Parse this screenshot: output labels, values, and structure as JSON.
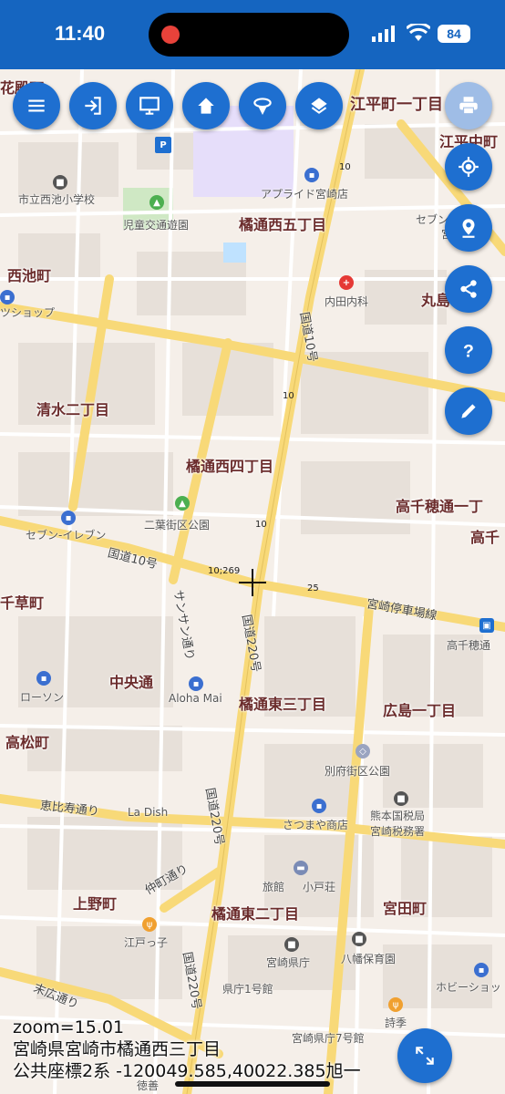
{
  "status_bar": {
    "time": "11:40",
    "battery": "84"
  },
  "toolbar": {
    "menu_icon": "menu-icon",
    "login_icon": "login-icon",
    "display_icon": "monitor-icon",
    "home_icon": "home-icon",
    "gps_icon": "gps-tracking-icon",
    "layers_icon": "layers-icon",
    "print_icon": "print-icon"
  },
  "side_buttons": [
    "my-location-icon",
    "place-pin-icon",
    "share-icon",
    "help-icon",
    "edit-icon"
  ],
  "map": {
    "areas": [
      {
        "id": "hirado",
        "text": "花殿町"
      },
      {
        "id": "ehira1",
        "text": "江平町一丁目"
      },
      {
        "id": "ehirachu",
        "text": "江平中町"
      },
      {
        "id": "tachibana5w",
        "text": "橘通西五丁目"
      },
      {
        "id": "nishiike",
        "text": "西池町"
      },
      {
        "id": "maru",
        "text": "丸島"
      },
      {
        "id": "shimizu2",
        "text": "清水二丁目"
      },
      {
        "id": "tachibana4w",
        "text": "橘通西四丁目"
      },
      {
        "id": "takachiho1",
        "text": "高千穂通一丁"
      },
      {
        "id": "takachiho",
        "text": "高千"
      },
      {
        "id": "chigusa",
        "text": "千草町"
      },
      {
        "id": "chuo",
        "text": "中央通"
      },
      {
        "id": "tachibana3e",
        "text": "橘通東三丁目"
      },
      {
        "id": "hiroshima1",
        "text": "広島一丁目"
      },
      {
        "id": "takamatsu",
        "text": "高松町"
      },
      {
        "id": "ueno",
        "text": "上野町"
      },
      {
        "id": "tachibana2e",
        "text": "橘通東二丁目"
      },
      {
        "id": "miyata",
        "text": "宮田町"
      }
    ],
    "places": [
      {
        "id": "school",
        "text": "市立西池小学校"
      },
      {
        "id": "park1",
        "text": "児童交通遊園"
      },
      {
        "id": "pharm",
        "text": "アプライド宮崎店"
      },
      {
        "id": "clinic",
        "text": "内田内科"
      },
      {
        "id": "shop",
        "text": "ツショップ"
      },
      {
        "id": "seven1",
        "text": "セブン-イレブン"
      },
      {
        "id": "park2",
        "text": "二葉街区公園"
      },
      {
        "id": "lawson",
        "text": "ローソン"
      },
      {
        "id": "aloha",
        "text": "Aloha Mai"
      },
      {
        "id": "takachihost",
        "text": "高千穂通"
      },
      {
        "id": "beppu",
        "text": "別府街区公園"
      },
      {
        "id": "tax",
        "text": "熊本国税局"
      },
      {
        "id": "tax2",
        "text": "宮崎税務署"
      },
      {
        "id": "satsuma",
        "text": "さつまや商店"
      },
      {
        "id": "ladish",
        "text": "La Dish"
      },
      {
        "id": "ryokan",
        "text": "旅館"
      },
      {
        "id": "koyaso",
        "text": "小戸荘"
      },
      {
        "id": "edokko",
        "text": "江戸っ子"
      },
      {
        "id": "pref",
        "text": "宮崎県庁"
      },
      {
        "id": "nursery",
        "text": "八幡保育園"
      },
      {
        "id": "kencho1",
        "text": "県庁1号館"
      },
      {
        "id": "kencho7",
        "text": "宮崎県庁7号館"
      },
      {
        "id": "shiki",
        "text": "詩季"
      },
      {
        "id": "hobby",
        "text": "ホビーショッ"
      },
      {
        "id": "seven2",
        "text": "セブン"
      },
      {
        "id": "miyazaki",
        "text": "宮崎"
      },
      {
        "id": "tokusho",
        "text": "徳善"
      }
    ],
    "roads": [
      {
        "id": "r10a",
        "text": "国道10号"
      },
      {
        "id": "r10b",
        "text": "国道10号"
      },
      {
        "id": "r220a",
        "text": "国道220号"
      },
      {
        "id": "r220b",
        "text": "国道220号"
      },
      {
        "id": "r220c",
        "text": "国道220号"
      },
      {
        "id": "sansan",
        "text": "サンサン通り"
      },
      {
        "id": "teisha",
        "text": "宮崎停車場線"
      },
      {
        "id": "ebisu",
        "text": "恵比寿通り"
      },
      {
        "id": "nakamachi",
        "text": "仲町通り"
      },
      {
        "id": "suehiro",
        "text": "末広通り"
      }
    ],
    "road_numbers": [
      {
        "id": "n1",
        "text": "10"
      },
      {
        "id": "n2",
        "text": "10"
      },
      {
        "id": "n3",
        "text": "10"
      },
      {
        "id": "n4",
        "text": "10;269"
      },
      {
        "id": "n5",
        "text": "25"
      }
    ]
  },
  "info": {
    "zoom": "zoom=15.01",
    "address": "宮崎県宮崎市橘通西三丁目",
    "coords": "公共座標2系 -120049.585,40022.385",
    "trailing": "旭一"
  },
  "fullscreen_icon": "fullscreen-expand-icon"
}
